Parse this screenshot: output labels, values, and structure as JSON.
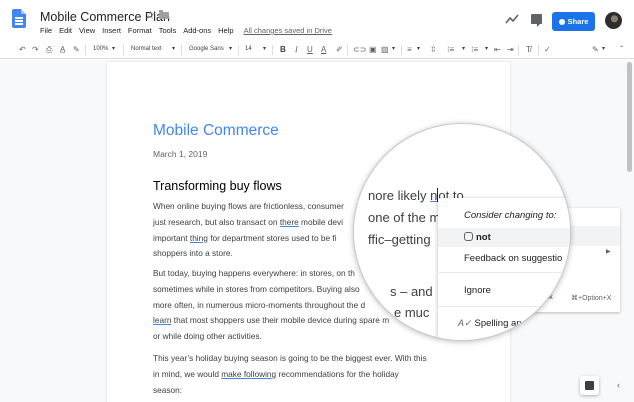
{
  "header": {
    "title": "Mobile Commerce Plan",
    "menu": [
      "File",
      "Edit",
      "View",
      "Insert",
      "Format",
      "Tools",
      "Add-ons",
      "Help"
    ],
    "saved_status": "All changes saved in Drive",
    "share_label": "Share"
  },
  "toolbar": {
    "zoom": "100%",
    "style": "Normal text",
    "font": "Google Sans",
    "font_size": "14",
    "bold": "B",
    "italic": "I",
    "underline": "U",
    "text_color": "A"
  },
  "document": {
    "title": "Mobile Commerce",
    "date": "March 1, 2019",
    "heading": "Transforming buy flows",
    "p1_lines": [
      "When online buying flows are frictionless, consumer",
      "just research, but also transact on there mobile devi",
      "important thing for department stores used to be fi",
      "shoppers into a store."
    ],
    "p2_lines": [
      "But today, buying happens everywhere: in stores, on th",
      "sometimes while in stores from competitors. Buying also",
      "more often, in numerous micro-moments throughout the d",
      "learn that most shoppers use their mobile device during spare m",
      "or while doing other activities."
    ],
    "p3_lines": [
      "This year’s holiday buying season is going to be the biggest ever. With this",
      "in mind, we would make following recommendations for the holiday",
      "season:"
    ]
  },
  "magnifier": {
    "line1": "nore likely not to",
    "line2": "one of the mo",
    "line3": "ffic–getting",
    "line4": "s – and",
    "line5": "e muc"
  },
  "suggestion_menu": {
    "title": "Consider changing to:",
    "suggestion": "not",
    "feedback": "Feedback on suggestio",
    "ignore": "Ignore",
    "spelling": "Spelling and",
    "spell_check_tail": "heck",
    "shortcut": "⌘+Option+X"
  },
  "colors": {
    "accent": "#1a73e8",
    "title_blue": "#4285f4"
  }
}
